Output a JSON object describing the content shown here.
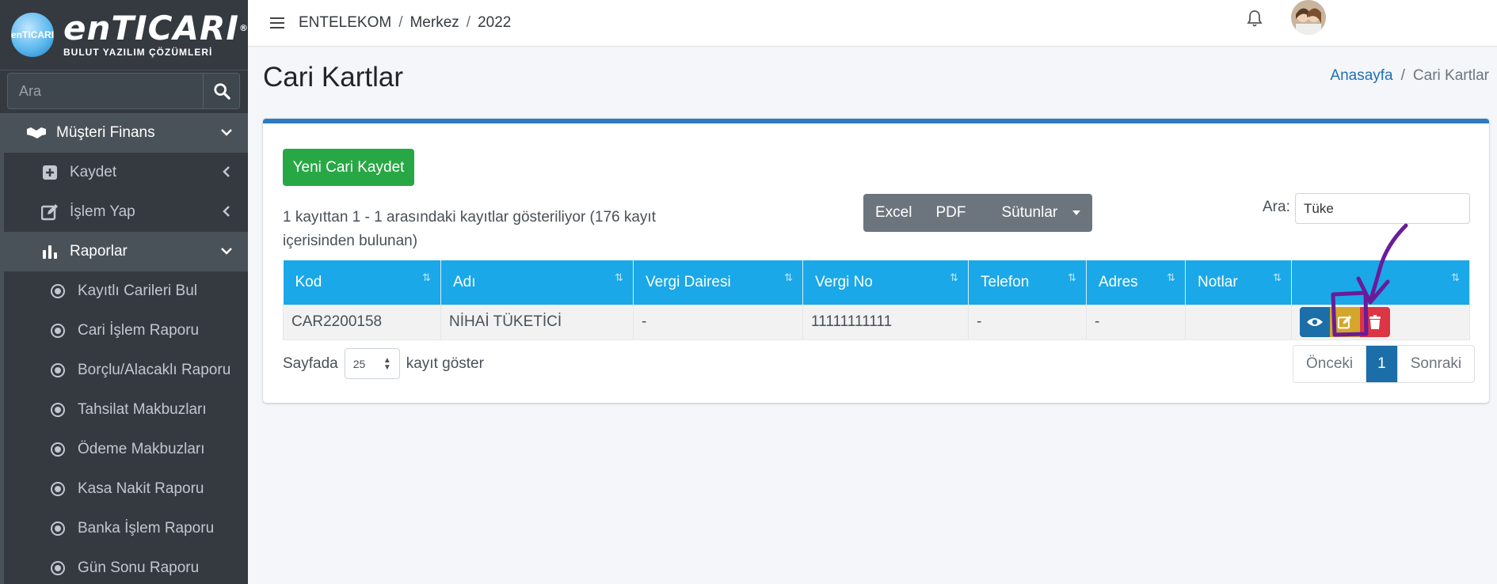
{
  "brand": {
    "logo_main": "enTICARI",
    "logo_sub": "BULUT YAZILIM ÇÖZÜMLERİ",
    "logo_mini": "enTICARI",
    "registered": "®"
  },
  "sidebar": {
    "search_placeholder": "Ara",
    "items": [
      {
        "label": "Müşteri Finans",
        "icon": "handshake-icon"
      },
      {
        "label": "Kaydet",
        "icon": "plus-square-icon"
      },
      {
        "label": "İşlem Yap",
        "icon": "edit-icon"
      },
      {
        "label": "Raporlar",
        "icon": "bar-chart-icon"
      },
      {
        "label": "Kayıtlı Carileri Bul"
      },
      {
        "label": "Cari İşlem Raporu"
      },
      {
        "label": "Borçlu/Alacaklı Raporu"
      },
      {
        "label": "Tahsilat Makbuzları"
      },
      {
        "label": "Ödeme Makbuzları"
      },
      {
        "label": "Kasa Nakit Raporu"
      },
      {
        "label": "Banka İşlem Raporu"
      },
      {
        "label": "Gün Sonu Raporu"
      }
    ]
  },
  "topbar": {
    "company": "ENTELEKOM",
    "branch": "Merkez",
    "year": "2022",
    "sep": "/"
  },
  "page": {
    "title": "Cari Kartlar",
    "breadcrumb_home": "Anasayfa",
    "breadcrumb_current": "Cari Kartlar",
    "sep": "/"
  },
  "toolbar": {
    "new_button": "Yeni Cari Kaydet",
    "info": "1 kayıttan 1 - 1 arasındaki kayıtlar gösteriliyor (176 kayıt içerisinden bulunan)",
    "excel": "Excel",
    "pdf": "PDF",
    "columns": "Sütunlar",
    "search_label": "Ara:",
    "search_value": "Tüke"
  },
  "table": {
    "headers": [
      "Kod",
      "Adı",
      "Vergi Dairesi",
      "Vergi No",
      "Telefon",
      "Adres",
      "Notlar",
      ""
    ],
    "rows": [
      [
        "CAR2200158",
        "NİHAİ TÜKETİCİ",
        "-",
        "11111111111",
        "-",
        "-",
        ""
      ]
    ]
  },
  "footer": {
    "show_prefix": "Sayfada",
    "page_size": "25",
    "show_suffix": "kayıt göster",
    "prev": "Önceki",
    "current_page": "1",
    "next": "Sonraki"
  },
  "colors": {
    "sidebar": "#343a40",
    "accent": "#1aa8e8",
    "success": "#28a745",
    "primary": "#1b6ea8",
    "warning": "#d4a72c",
    "danger": "#dc3545",
    "annotation": "#6a1b9a"
  }
}
